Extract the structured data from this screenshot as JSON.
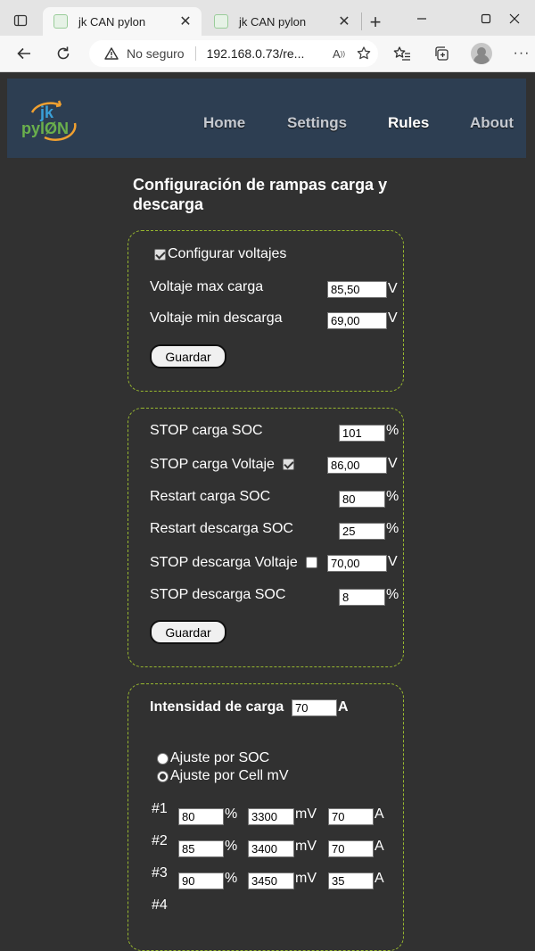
{
  "browser": {
    "tabs": [
      {
        "title": "jk CAN pylon",
        "active": true
      },
      {
        "title": "jk CAN pylon",
        "active": false
      }
    ],
    "security_text": "No seguro",
    "url": "192.168.0.73/re..."
  },
  "nav": {
    "logo_top": "jk",
    "logo_bottom": "pylØN",
    "links": [
      "Home",
      "Settings",
      "Rules",
      "About"
    ],
    "active": "Rules"
  },
  "page_title": "Configuración de rampas carga y descarga",
  "voltage_card": {
    "enable_label": "Configurar voltajes",
    "enabled": true,
    "max_label": "Voltaje max carga",
    "max_value": "85,50",
    "min_label": "Voltaje min descarga",
    "min_value": "69,00",
    "unit": "V",
    "save_label": "Guardar"
  },
  "soc_card": {
    "rows": [
      {
        "label": "STOP carga SOC",
        "value": "101",
        "unit": "%"
      },
      {
        "label": "STOP carga Voltaje",
        "value": "86,00",
        "unit": "V",
        "checked": true
      },
      {
        "label": "Restart carga SOC",
        "value": "80",
        "unit": "%"
      },
      {
        "label": "Restart descarga SOC",
        "value": "25",
        "unit": "%"
      },
      {
        "label": "STOP descarga Voltaje",
        "value": "70,00",
        "unit": "V",
        "checked": false
      },
      {
        "label": "STOP descarga SOC",
        "value": "8",
        "unit": "%"
      }
    ],
    "save_label": "Guardar"
  },
  "current_card": {
    "title": "Intensidad de carga",
    "value": "70",
    "unit": "A",
    "modes": [
      {
        "label": "Ajuste por SOC",
        "selected": false
      },
      {
        "label": "Ajuste por Cell mV",
        "selected": true
      }
    ],
    "steps": [
      {
        "id": "#1",
        "soc": "80",
        "mv": "3300",
        "amps": "70"
      },
      {
        "id": "#2",
        "soc": "85",
        "mv": "3400",
        "amps": "70"
      },
      {
        "id": "#3",
        "soc": "90",
        "mv": "3450",
        "amps": "35"
      },
      {
        "id": "#4"
      }
    ],
    "unit_pct": "%",
    "unit_mv": "mV",
    "unit_a": "A"
  },
  "colors": {
    "page_bg": "#313131",
    "navbar_bg": "#2d3e52",
    "card_border": "#98b82f",
    "logo_blue": "#3aa0d8",
    "logo_green": "#6ab04c",
    "logo_orange": "#f0a030"
  }
}
